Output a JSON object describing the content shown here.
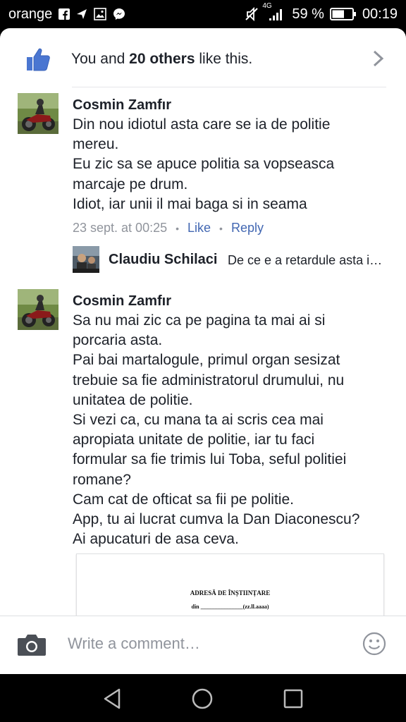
{
  "status_bar": {
    "carrier": "orange",
    "network": "4G",
    "battery": "59 %",
    "time": "00:19",
    "icons": [
      "facebook-icon",
      "send-icon",
      "gallery-icon",
      "messenger-icon",
      "mute-icon",
      "signal-icon",
      "battery-icon"
    ]
  },
  "likes": {
    "prefix": "You and ",
    "count_label": "20 others",
    "suffix": " like this."
  },
  "comments": [
    {
      "author": "Cosmin Zamfır",
      "lines": [
        "Din nou idiotul asta care se ia de politie",
        "mereu.",
        "Eu zic sa se apuce politia sa vopseasca",
        "marcaje pe drum.",
        "Idiot, iar unii il mai baga si in seama"
      ],
      "timestamp": "23 sept. at 00:25",
      "like_label": "Like",
      "reply_label": "Reply",
      "reply_preview": {
        "author": "Claudiu Schilaci",
        "snippet": "De ce e a retardule asta i…"
      }
    },
    {
      "author": "Cosmin Zamfır",
      "lines": [
        "Sa nu mai zic ca pe pagina ta mai ai si",
        "porcaria asta.",
        "Pai bai martalogule, primul organ sesizat",
        "trebuie sa fie administratorul drumului, nu",
        "unitatea de politie.",
        "Si vezi ca, cu mana ta ai scris cea mai",
        "apropiata unitate de politie, iar tu faci",
        "formular sa fie trimis lui Toba, seful politiei",
        "romane?",
        "Cam cat de ofticat sa fii pe politie.",
        "App, tu ai lucrat cumva la Dan Diaconescu?",
        "Ai apucaturi de asa ceva."
      ],
      "attachment": {
        "title": "ADRESĂ DE ÎNȘTIINȚARE",
        "line": "din _______________(zz.ll.aaaa)"
      }
    }
  ],
  "composer": {
    "placeholder": "Write a comment…"
  },
  "colors": {
    "link": "#4267b2",
    "like_blue": "#4a76d1",
    "meta_gray": "#90949c",
    "text": "#1d2129"
  }
}
